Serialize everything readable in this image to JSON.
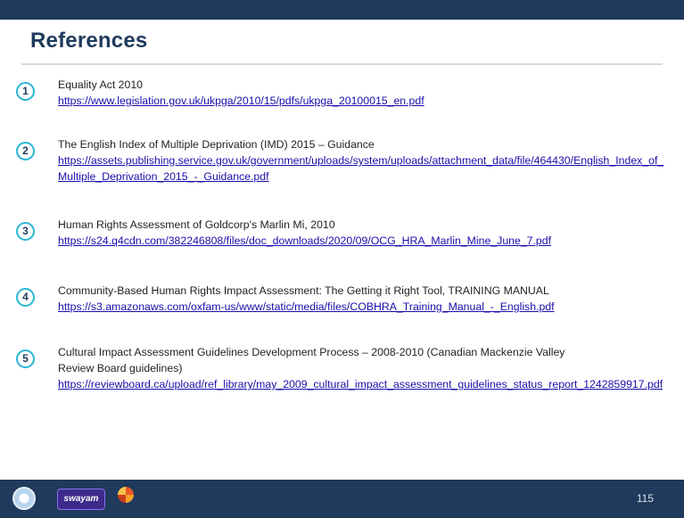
{
  "slide": {
    "title": "References",
    "page_number": "115"
  },
  "references": [
    {
      "number": "1",
      "text": "Equality Act 2010",
      "link": "https://www.legislation.gov.uk/ukpga/2010/15/pdfs/ukpga_20100015_en.pdf"
    },
    {
      "number": "2",
      "text": "The English Index of Multiple Deprivation (IMD) 2015 – Guidance",
      "link": "https://assets.publishing.service.gov.uk/government/uploads/system/uploads/attachment_data/file/464430/English_Index_of_Multiple_Deprivation_2015_-_Guidance.pdf"
    },
    {
      "number": "3",
      "text": "Human Rights Assessment of Goldcorp's Marlin Mi, 2010",
      "link": "https://s24.q4cdn.com/382246808/files/doc_downloads/2020/09/OCG_HRA_Marlin_Mine_June_7.pdf"
    },
    {
      "number": "4",
      "text": "Community-Based Human Rights Impact Assessment: The Getting it Right Tool, TRAINING MANUAL",
      "link": "https://s3.amazonaws.com/oxfam-us/www/static/media/files/COBHRA_Training_Manual_-_English.pdf"
    },
    {
      "number": "5",
      "text": "Cultural Impact Assessment Guidelines Development Process – 2008-2010 (Canadian Mackenzie Valley\nReview Board guidelines)",
      "link": "https://reviewboard.ca/upload/ref_library/may_2009_cultural_impact_assessment_guidelines_status_report_1242859917.pdf"
    }
  ],
  "footer": {
    "swayam_label": "swayam"
  },
  "colors": {
    "header_bar": "#1f3a5c",
    "number_ring": "#29b6d6",
    "link": "#1a0dab"
  }
}
